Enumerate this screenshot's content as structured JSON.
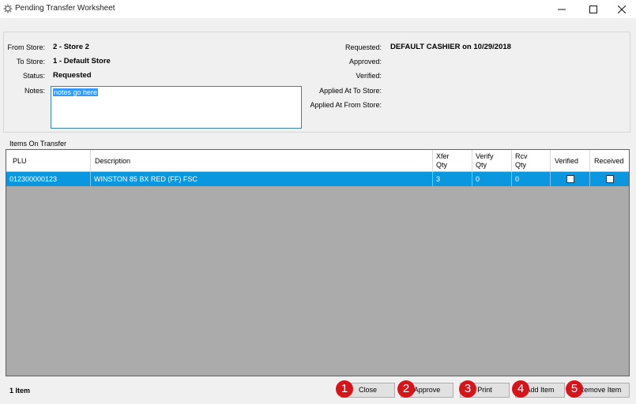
{
  "window": {
    "title": "Pending Transfer Worksheet",
    "minimize_glyph": "—",
    "maximize_glyph": "☐",
    "close_glyph": "✕"
  },
  "header": {
    "from_store_label": "From Store:",
    "from_store_value": "2 - Store 2",
    "to_store_label": "To Store:",
    "to_store_value": "1 - Default Store",
    "status_label": "Status:",
    "status_value": "Requested",
    "notes_label": "Notes:",
    "notes_value": "notes go here",
    "requested_label": "Requested:",
    "requested_value": "DEFAULT CASHIER on 10/29/2018",
    "approved_label": "Approved:",
    "verified_label": "Verified:",
    "applied_to_label": "Applied At To Store:",
    "applied_from_label": "Applied At From Store:"
  },
  "items": {
    "group_label": "Items On Transfer",
    "columns": {
      "plu": "PLU",
      "description": "Description",
      "xfer_qty_1": "Xfer",
      "xfer_qty_2": "Qty",
      "verify_qty_1": "Verify",
      "verify_qty_2": "Qty",
      "rcv_qty_1": "Rcv",
      "rcv_qty_2": "Qty",
      "verified": "Verified",
      "received": "Received"
    },
    "rows": [
      {
        "plu": "012300000123",
        "description": "WINSTON 85 BX RED (FF) FSC",
        "xfer_qty": "3",
        "verify_qty": "0",
        "rcv_qty": "0",
        "verified": false,
        "received": false
      }
    ]
  },
  "footer": {
    "count_text": "1 Item",
    "close_label": "Close",
    "approve_label": "Approve",
    "print_label": "Print",
    "add_item_label": "Add Item",
    "remove_item_label": "Remove Item",
    "badge_1": "1",
    "badge_2": "2",
    "badge_3": "3",
    "badge_4": "4",
    "badge_5": "5"
  },
  "colors": {
    "selection": "#0a97e0",
    "badge": "#d8141b",
    "grid_bg": "#ababab",
    "notes_border": "#3c7fb1"
  }
}
